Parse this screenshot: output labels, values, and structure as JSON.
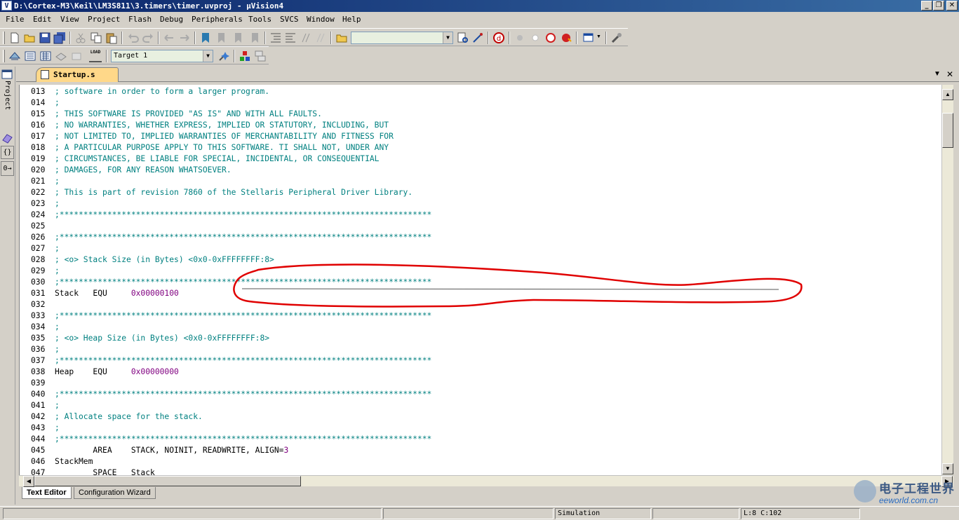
{
  "window": {
    "icon_label": "V",
    "title": "D:\\Cortex-M3\\Keil\\LM3S811\\3.timers\\timer.uvproj - µVision4",
    "controls": [
      "_",
      "❐",
      "✕"
    ]
  },
  "menu": [
    "File",
    "Edit",
    "View",
    "Project",
    "Flash",
    "Debug",
    "Peripherals",
    "Tools",
    "SVCS",
    "Window",
    "Help"
  ],
  "toolbar": {
    "search_combo_value": "",
    "target_combo_value": "Target 1",
    "load_label": "LOAD"
  },
  "side_panel": {
    "project_tab": "Project",
    "books_icon": "books-icon",
    "functions_tab": "{}",
    "templates_tab": "0→"
  },
  "editor_tab": {
    "file_name": "Startup.s",
    "dropdown": "▼",
    "close": "✕"
  },
  "code_lines": [
    {
      "n": "013",
      "t": "; software in order to form a larger program.",
      "k": "cmt"
    },
    {
      "n": "014",
      "t": ";",
      "k": "cmt"
    },
    {
      "n": "015",
      "t": "; THIS SOFTWARE IS PROVIDED \"AS IS\" AND WITH ALL FAULTS.",
      "k": "cmt"
    },
    {
      "n": "016",
      "t": "; NO WARRANTIES, WHETHER EXPRESS, IMPLIED OR STATUTORY, INCLUDING, BUT",
      "k": "cmt"
    },
    {
      "n": "017",
      "t": "; NOT LIMITED TO, IMPLIED WARRANTIES OF MERCHANTABILITY AND FITNESS FOR",
      "k": "cmt"
    },
    {
      "n": "018",
      "t": "; A PARTICULAR PURPOSE APPLY TO THIS SOFTWARE. TI SHALL NOT, UNDER ANY",
      "k": "cmt"
    },
    {
      "n": "019",
      "t": "; CIRCUMSTANCES, BE LIABLE FOR SPECIAL, INCIDENTAL, OR CONSEQUENTIAL",
      "k": "cmt"
    },
    {
      "n": "020",
      "t": "; DAMAGES, FOR ANY REASON WHATSOEVER.",
      "k": "cmt"
    },
    {
      "n": "021",
      "t": ";",
      "k": "cmt"
    },
    {
      "n": "022",
      "t": "; This is part of revision 7860 of the Stellaris Peripheral Driver Library.",
      "k": "cmt"
    },
    {
      "n": "023",
      "t": ";",
      "k": "cmt"
    },
    {
      "n": "024",
      "t": ";******************************************************************************",
      "k": "cmt"
    },
    {
      "n": "025",
      "t": "",
      "k": "cmt"
    },
    {
      "n": "026",
      "t": ";******************************************************************************",
      "k": "cmt"
    },
    {
      "n": "027",
      "t": ";",
      "k": "cmt"
    },
    {
      "n": "028",
      "t": "; <o> Stack Size (in Bytes) <0x0-0xFFFFFFFF:8>",
      "k": "cmt"
    },
    {
      "n": "029",
      "t": ";",
      "k": "cmt"
    },
    {
      "n": "030",
      "t": ";******************************************************************************",
      "k": "cmt"
    },
    {
      "n": "031",
      "t": "Stack   EQU     ",
      "k": "kw",
      "v": "0x00000100"
    },
    {
      "n": "032",
      "t": "",
      "k": "cmt"
    },
    {
      "n": "033",
      "t": ";******************************************************************************",
      "k": "cmt"
    },
    {
      "n": "034",
      "t": ";",
      "k": "cmt"
    },
    {
      "n": "035",
      "t": "; <o> Heap Size (in Bytes) <0x0-0xFFFFFFFF:8>",
      "k": "cmt"
    },
    {
      "n": "036",
      "t": ";",
      "k": "cmt"
    },
    {
      "n": "037",
      "t": ";******************************************************************************",
      "k": "cmt"
    },
    {
      "n": "038",
      "t": "Heap    EQU     ",
      "k": "kw",
      "v": "0x00000000"
    },
    {
      "n": "039",
      "t": "",
      "k": "cmt"
    },
    {
      "n": "040",
      "t": ";******************************************************************************",
      "k": "cmt"
    },
    {
      "n": "041",
      "t": ";",
      "k": "cmt"
    },
    {
      "n": "042",
      "t": "; Allocate space for the stack.",
      "k": "cmt"
    },
    {
      "n": "043",
      "t": ";",
      "k": "cmt"
    },
    {
      "n": "044",
      "t": ";******************************************************************************",
      "k": "cmt"
    },
    {
      "n": "045",
      "t": "        AREA    STACK, NOINIT, READWRITE, ALIGN=",
      "k": "kw",
      "v": "3"
    },
    {
      "n": "046",
      "t": "StackMem",
      "k": "kw"
    },
    {
      "n": "047",
      "t": "        SPACE   Stack",
      "k": "kw"
    }
  ],
  "bottom_tabs": [
    "Text Editor",
    "Configuration Wizard"
  ],
  "status": {
    "mode": "Simulation",
    "position": "L:8 C:102"
  },
  "watermark": {
    "cn": "电子工程世界",
    "en": "eeworld.com.cn"
  },
  "colors": {
    "comment": "#008080",
    "number": "#800080",
    "tab_active": "#ffd889",
    "annotation": "#e00000"
  }
}
